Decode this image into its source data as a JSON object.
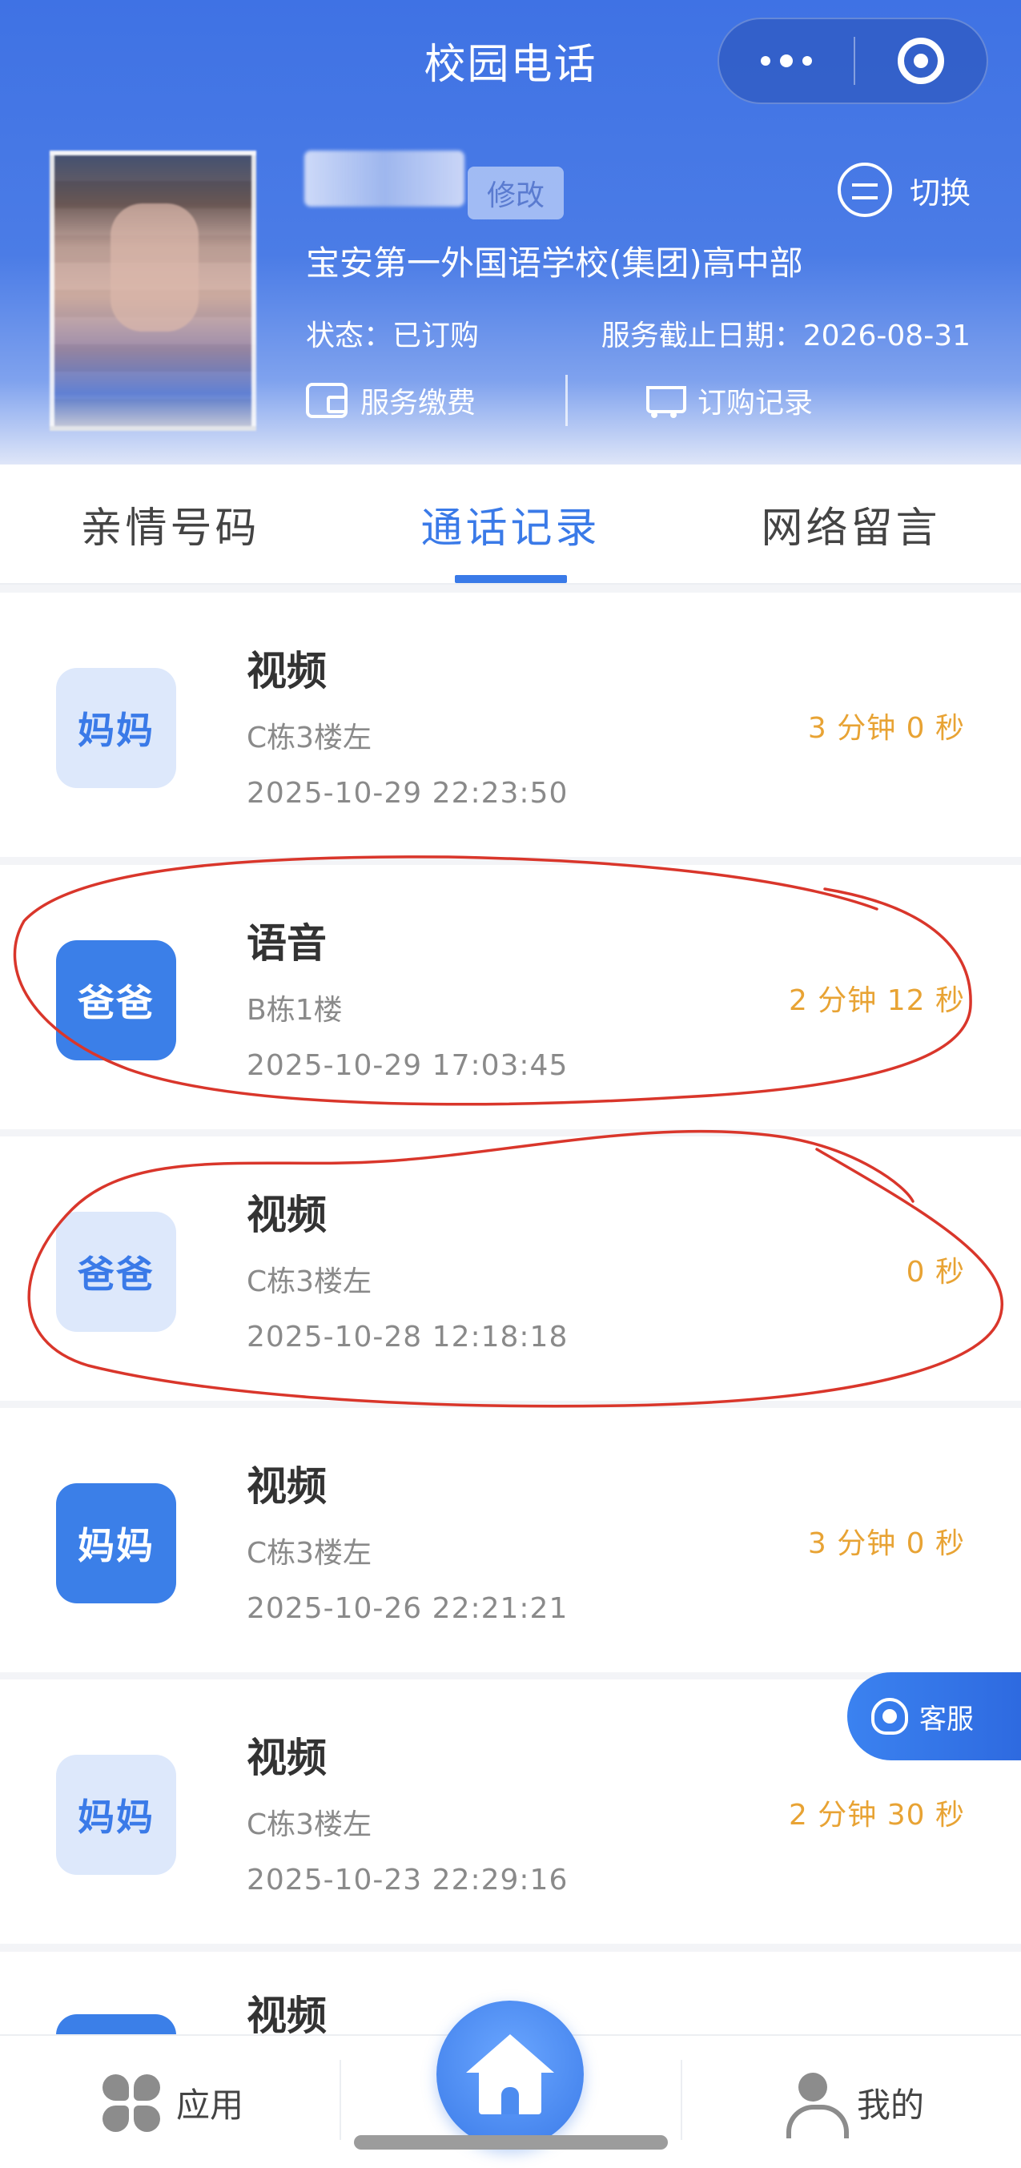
{
  "nav": {
    "title": "校园电话",
    "more_icon": "more-dots-icon",
    "target_icon": "target-icon"
  },
  "profile": {
    "edit_label": "修改",
    "switch_label": "切换",
    "school": "宝安第一外国语学校(集团)高中部",
    "status": "状态：已订购",
    "expiry": "服务截止日期：2026-08-31",
    "pay_label": "服务缴费",
    "orders_label": "订购记录"
  },
  "tabs": [
    {
      "label": "亲情号码",
      "active": false
    },
    {
      "label": "通话记录",
      "active": true
    },
    {
      "label": "网络留言",
      "active": false
    }
  ],
  "records": [
    {
      "badge": "妈妈",
      "style": "light",
      "type": "视频",
      "location": "C栋3楼左",
      "time": "2025-10-29 22:23:50",
      "duration": "3 分钟 0 秒"
    },
    {
      "badge": "爸爸",
      "style": "dark",
      "type": "语音",
      "location": "B栋1楼",
      "time": "2025-10-29 17:03:45",
      "duration": "2 分钟 12 秒"
    },
    {
      "badge": "爸爸",
      "style": "light",
      "type": "视频",
      "location": "C栋3楼左",
      "time": "2025-10-28 12:18:18",
      "duration": "0 秒"
    },
    {
      "badge": "妈妈",
      "style": "dark",
      "type": "视频",
      "location": "C栋3楼左",
      "time": "2025-10-26 22:21:21",
      "duration": "3 分钟 0 秒"
    },
    {
      "badge": "妈妈",
      "style": "light",
      "type": "视频",
      "location": "C栋3楼左",
      "time": "2025-10-23 22:29:16",
      "duration": "2 分钟 30 秒"
    }
  ],
  "partial_record": {
    "type": "视频"
  },
  "service": {
    "label": "客服"
  },
  "bottom_nav": {
    "apps_label": "应用",
    "mine_label": "我的",
    "home_icon": "home-icon"
  },
  "colors": {
    "primary": "#3a7ae8",
    "duration": "#e8a334",
    "annotation": "#d9362b"
  }
}
